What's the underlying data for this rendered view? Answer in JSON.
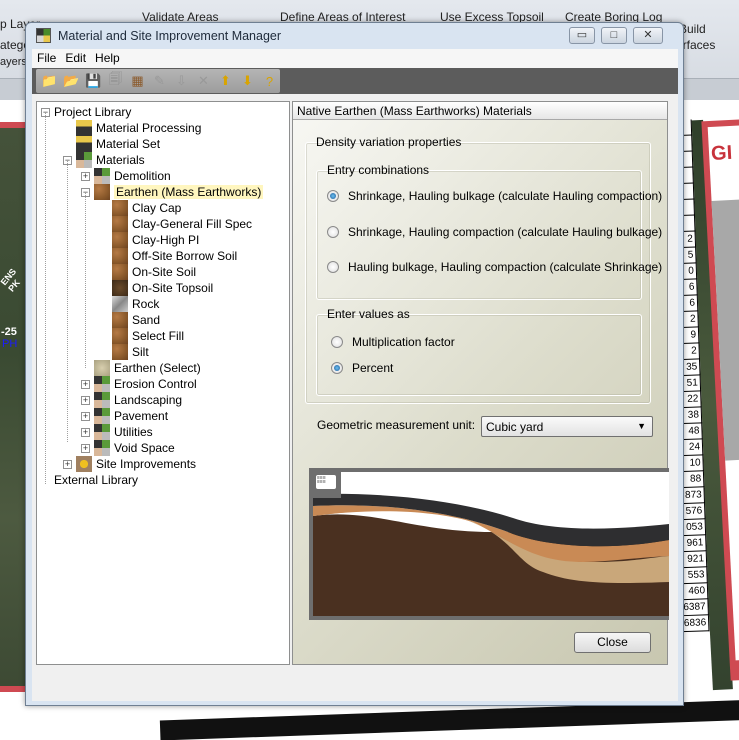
{
  "background": {
    "ribbon_fragments": [
      "p Layer",
      "ategor",
      "ayers",
      "Validate Areas",
      "Define Areas of Interest",
      "Use Excess Topsoil",
      "Create Boring Log",
      "Build",
      "Surfaces"
    ],
    "map_labels": [
      "ENS PK",
      "-25",
      "PH"
    ],
    "table_values": [
      "",
      "",
      "",
      "",
      "",
      "",
      "",
      "2",
      "5",
      "0",
      "6",
      "6",
      "2",
      "9",
      "2",
      "35",
      "51",
      "22",
      "38",
      "48",
      "24",
      "10",
      "88",
      "873",
      "576",
      "053",
      "961",
      "921",
      "553",
      "460",
      "6387",
      "6836"
    ],
    "poster_logo": "GI"
  },
  "window": {
    "title": "Material and Site Improvement Manager",
    "min": "▭",
    "max": "□",
    "close": "✕"
  },
  "menu": [
    "File",
    "Edit",
    "Help"
  ],
  "toolbar": [
    {
      "name": "new-folder-icon",
      "glyph": "📁"
    },
    {
      "name": "import-icon",
      "glyph": "📂"
    },
    {
      "name": "save-icon",
      "glyph": "💾"
    },
    {
      "name": "save-all-icon",
      "glyph": "🗐"
    },
    {
      "name": "add-material-icon",
      "glyph": "▦"
    },
    {
      "name": "edit-icon",
      "glyph": "✎"
    },
    {
      "name": "move-down-icon",
      "glyph": "⇩"
    },
    {
      "name": "delete-icon",
      "glyph": "✕"
    },
    {
      "name": "move-up-pin-icon",
      "glyph": "⬆"
    },
    {
      "name": "move-down-pin-icon",
      "glyph": "⬇"
    },
    {
      "name": "help-icon",
      "glyph": "?"
    }
  ],
  "tree": {
    "project_library": "Project Library",
    "material_processing": "Material Processing",
    "material_set": "Material Set",
    "materials": "Materials",
    "demolition": "Demolition",
    "earthen_mass": "Earthen (Mass Earthworks)",
    "earthen_children": [
      "Clay Cap",
      "Clay-General Fill Spec",
      "Clay-High PI",
      "Off-Site Borrow Soil",
      "On-Site Soil",
      "On-Site Topsoil",
      "Rock",
      "Sand",
      "Select Fill",
      "Silt"
    ],
    "earthen_select": "Earthen (Select)",
    "groups": [
      "Erosion Control",
      "Landscaping",
      "Pavement",
      "Utilities",
      "Void Space"
    ],
    "site_improvements": "Site Improvements",
    "external_library": "External Library",
    "selected": "Earthen (Mass Earthworks)"
  },
  "panel": {
    "header": "Native Earthen (Mass Earthworks) Materials",
    "density_group": "Density variation properties",
    "entry_group": "Entry combinations",
    "entry_options": [
      {
        "label": "Shrinkage, Hauling bulkage (calculate Hauling compaction)",
        "checked": true
      },
      {
        "label": "Shrinkage, Hauling compaction (calculate Hauling bulkage)",
        "checked": false
      },
      {
        "label": "Hauling bulkage, Hauling compaction  (calculate Shrinkage)",
        "checked": false
      }
    ],
    "values_group": "Enter values as",
    "value_options": [
      {
        "label": "Multiplication factor",
        "checked": false
      },
      {
        "label": "Percent",
        "checked": true
      }
    ],
    "unit_label": "Geometric measurement unit:",
    "unit_value": "Cubic yard",
    "close": "Close"
  }
}
